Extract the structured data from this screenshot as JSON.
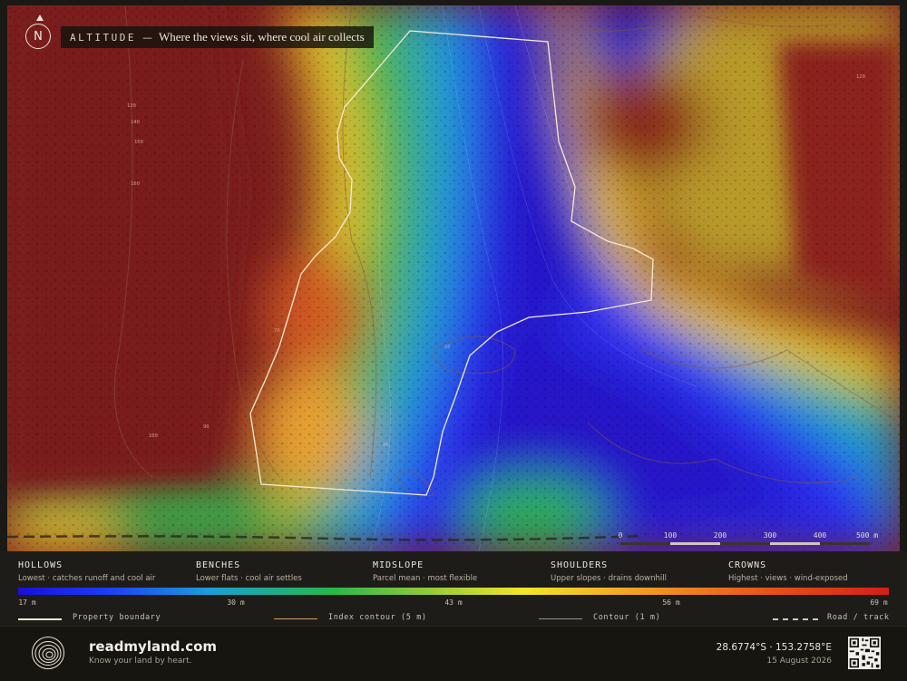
{
  "header": {
    "north_label": "N",
    "kicker": "ALTITUDE",
    "dash": "—",
    "subtitle": "Where the views sit, where cool air collects"
  },
  "map": {
    "contour_labels": [
      "130",
      "140",
      "150",
      "160",
      "70",
      "90",
      "100",
      "80",
      "20",
      "120"
    ]
  },
  "scale_bar": {
    "labels": [
      "0",
      "100",
      "200",
      "300",
      "400",
      "500 m"
    ]
  },
  "zones": [
    {
      "name": "HOLLOWS",
      "desc": "Lowest · catches runoff and cool air"
    },
    {
      "name": "BENCHES",
      "desc": "Lower flats · cool air settles"
    },
    {
      "name": "MIDSLOPE",
      "desc": "Parcel mean · most flexible"
    },
    {
      "name": "SHOULDERS",
      "desc": "Upper slopes · drains downhill"
    },
    {
      "name": "CROWNS",
      "desc": "Highest · views · wind-exposed"
    }
  ],
  "ramp_ticks": [
    "17 m",
    "30 m",
    "43 m",
    "56 m",
    "69 m"
  ],
  "line_key": {
    "boundary": "Property boundary",
    "index_contour": "Index contour (5 m)",
    "contour": "Contour (1 m)",
    "road": "Road / track"
  },
  "footer": {
    "brand": "readmyland.com",
    "tagline": "Know your land by heart.",
    "coords": "28.6774°S · 153.2758°E",
    "date": "15 August 2026"
  },
  "colors": {
    "low": "#1a0fd8",
    "mid": "#26b84a",
    "high": "#d21e1a",
    "boundary": "#f3ead2",
    "index_contour": "#d49a6a"
  }
}
